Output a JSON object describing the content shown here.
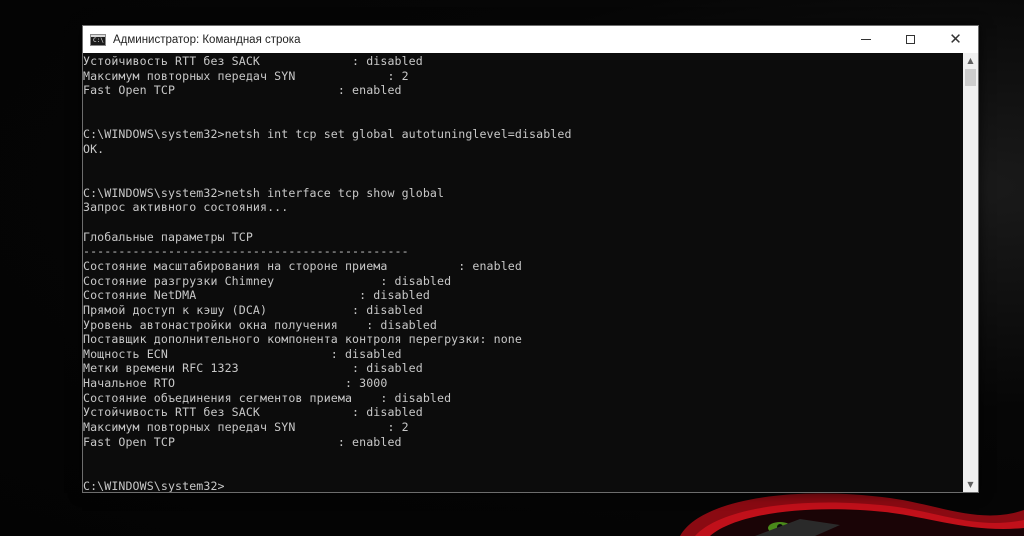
{
  "window": {
    "title": "Администратор: Командная строка",
    "icon_text": "C:\\",
    "minimize_label": "minimize",
    "maximize_label": "maximize",
    "close_label": "✕"
  },
  "console": {
    "lines": [
      "Устойчивость RTT без SACK             : disabled",
      "Максимум повторных передач SYN             : 2",
      "Fast Open TCP                       : enabled",
      "",
      "",
      "C:\\WINDOWS\\system32>netsh int tcp set global autotuninglevel=disabled",
      "ОК.",
      "",
      "",
      "C:\\WINDOWS\\system32>netsh interface tcp show global",
      "Запрос активного состояния...",
      "",
      "Глобальные параметры TCP",
      "----------------------------------------------",
      "Состояние масштабирования на стороне приема          : enabled",
      "Состояние разгрузки Chimney               : disabled",
      "Состояние NetDMA                       : disabled",
      "Прямой доступ к кэшу (DCA)            : disabled",
      "Уровень автонастройки окна получения    : disabled",
      "Поставщик дополнительного компонента контроля перегрузки: none",
      "Мощность ECN                       : disabled",
      "Метки времени RFC 1323                : disabled",
      "Начальное RTO                        : 3000",
      "Состояние объединения сегментов приема    : disabled",
      "Устойчивость RTT без SACK             : disabled",
      "Максимум повторных передач SYN             : 2",
      "Fast Open TCP                       : enabled",
      "",
      "",
      "C:\\WINDOWS\\system32>"
    ]
  },
  "scrollbar": {
    "up_arrow": "▲",
    "down_arrow": "▼",
    "position": 0.02
  },
  "colors": {
    "console_bg": "#0c0c0c",
    "console_text": "#c8c8c8",
    "titlebar_bg": "#ffffff",
    "wallpaper_accent": "#c0101a"
  }
}
